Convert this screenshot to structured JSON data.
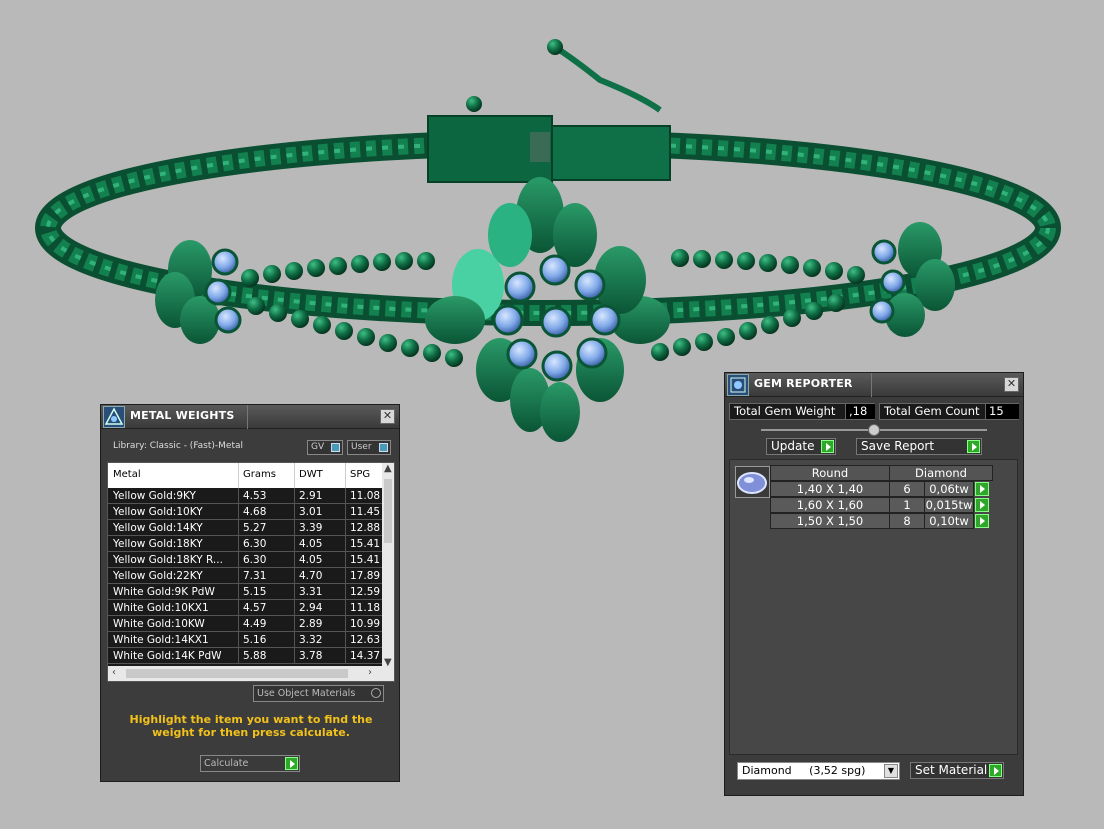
{
  "colors": {
    "metal": "#0f6e45",
    "gem": "#7fa8e8",
    "background": "#b9b9b9",
    "panel": "#3c3c3c",
    "go_button": "#2fa829",
    "help_text": "#f2c21b"
  },
  "metal_weights": {
    "title": "METAL WEIGHTS",
    "library": "Library: Classic - (Fast)-Metal",
    "toggle_gv": "GV",
    "toggle_user": "User",
    "columns": [
      "Metal",
      "Grams",
      "DWT",
      "SPG"
    ],
    "rows": [
      {
        "metal": "Yellow Gold:9KY",
        "grams": "4.53",
        "dwt": "2.91",
        "spg": "11.08"
      },
      {
        "metal": "Yellow Gold:10KY",
        "grams": "4.68",
        "dwt": "3.01",
        "spg": "11.45"
      },
      {
        "metal": "Yellow Gold:14KY",
        "grams": "5.27",
        "dwt": "3.39",
        "spg": "12.88"
      },
      {
        "metal": "Yellow Gold:18KY",
        "grams": "6.30",
        "dwt": "4.05",
        "spg": "15.41"
      },
      {
        "metal": "Yellow Gold:18KY R...",
        "grams": "6.30",
        "dwt": "4.05",
        "spg": "15.41"
      },
      {
        "metal": "Yellow Gold:22KY",
        "grams": "7.31",
        "dwt": "4.70",
        "spg": "17.89"
      },
      {
        "metal": "White Gold:9K PdW",
        "grams": "5.15",
        "dwt": "3.31",
        "spg": "12.59"
      },
      {
        "metal": "White Gold:10KX1",
        "grams": "4.57",
        "dwt": "2.94",
        "spg": "11.18"
      },
      {
        "metal": "White Gold:10KW",
        "grams": "4.49",
        "dwt": "2.89",
        "spg": "10.99"
      },
      {
        "metal": "White Gold:14KX1",
        "grams": "5.16",
        "dwt": "3.32",
        "spg": "12.63"
      },
      {
        "metal": "White Gold:14K PdW",
        "grams": "5.88",
        "dwt": "3.78",
        "spg": "14.37"
      }
    ],
    "use_object_materials": "Use Object Materials",
    "help": "Highlight the item you want to find the weight for then press calculate.",
    "calculate_label": "Calculate"
  },
  "gem_reporter": {
    "title": "GEM REPORTER",
    "total_gem_weight_label": "Total Gem Weight",
    "total_gem_weight": ",18",
    "total_gem_count_label": "Total Gem Count",
    "total_gem_count": "15",
    "update_label": "Update",
    "save_report_label": "Save Report",
    "header_shape": "Round",
    "header_material": "Diamond",
    "rows": [
      {
        "size": "1,40 X 1,40",
        "count": "6",
        "weight": "0,06tw"
      },
      {
        "size": "1,60 X 1,60",
        "count": "1",
        "weight": "0,015tw"
      },
      {
        "size": "1,50 X 1,50",
        "count": "8",
        "weight": "0,10tw"
      }
    ],
    "material_select": "Diamond     (3,52 spg)",
    "set_material_label": "Set Material"
  }
}
